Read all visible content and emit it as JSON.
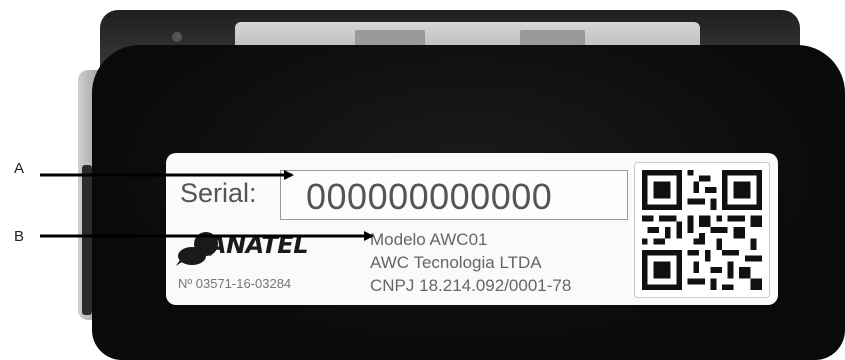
{
  "callouts": [
    {
      "letter": "A"
    },
    {
      "letter": "B"
    }
  ],
  "label": {
    "serial_caption": "Serial:",
    "serial_number": "000000000000",
    "brand_word": "ANATEL",
    "certificate_number": "Nº 03571-16-03284",
    "model": "Modelo AWC01",
    "company": "AWC Tecnologia LTDA",
    "cnpj": "CNPJ 18.214.092/0001-78"
  },
  "colors": {
    "device": "#0d0d0d",
    "label_background": "#fafafa",
    "label_text": "#555555",
    "arrow": "#000000"
  },
  "icons": [
    "anatel-logo-icon",
    "qr-code-icon"
  ]
}
